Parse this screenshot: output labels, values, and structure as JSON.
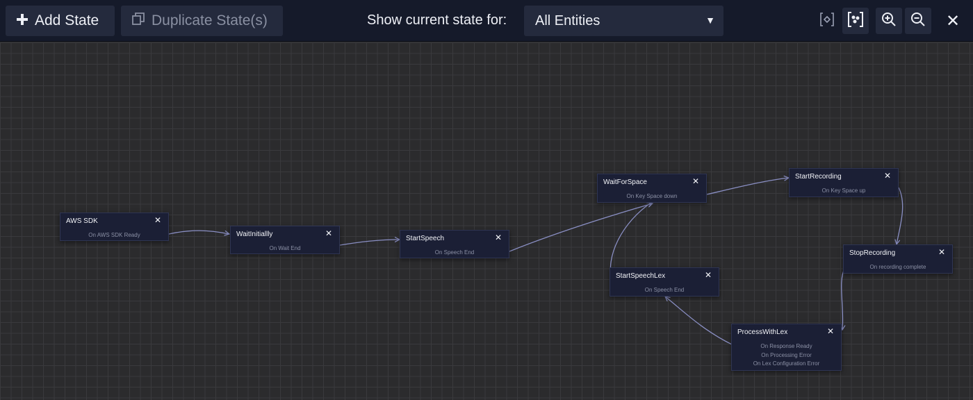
{
  "toolbar": {
    "add_state_label": "Add State",
    "duplicate_state_label": "Duplicate State(s)",
    "show_current_label": "Show current state for:",
    "entity_select_value": "All Entities",
    "icons": [
      "plus-icon",
      "duplicate-icon",
      "chevron-down-icon",
      "fit-selection-icon",
      "fit-all-icon",
      "zoom-in-icon",
      "zoom-out-icon",
      "close-icon"
    ]
  },
  "colors": {
    "toolbar_bg": "#151a2a",
    "button_bg": "#242a3d",
    "canvas_bg": "#2b2b2d",
    "node_bg": "#1b1f35",
    "edge": "#8a8fc4"
  },
  "states": {
    "aws_sdk": {
      "name": "AWS SDK",
      "events": [
        "On AWS SDK Ready"
      ]
    },
    "wait_initially": {
      "name": "WaitInitiallly",
      "events": [
        "On Wait End"
      ]
    },
    "start_speech": {
      "name": "StartSpeech",
      "events": [
        "On Speech End"
      ]
    },
    "wait_for_space": {
      "name": "WaitForSpace",
      "events": [
        "On Key Space down"
      ]
    },
    "start_recording": {
      "name": "StartRecording",
      "events": [
        "On Key Space up"
      ]
    },
    "stop_recording": {
      "name": "StopRecording",
      "events": [
        "On recording complete"
      ]
    },
    "start_speech_lex": {
      "name": "StartSpeechLex",
      "events": [
        "On Speech End"
      ]
    },
    "process_with_lex": {
      "name": "ProcessWithLex",
      "events": [
        "On Response Ready",
        "On Processing Error",
        "On Lex Configuration Error"
      ]
    }
  },
  "transitions": [
    {
      "from": "AWS SDK",
      "event": "On AWS SDK Ready",
      "to": "WaitInitiallly"
    },
    {
      "from": "WaitInitiallly",
      "event": "On Wait End",
      "to": "StartSpeech"
    },
    {
      "from": "StartSpeech",
      "event": "On Speech End",
      "to": "WaitForSpace"
    },
    {
      "from": "WaitForSpace",
      "event": "On Key Space down",
      "to": "StartRecording"
    },
    {
      "from": "StartRecording",
      "event": "On Key Space up",
      "to": "StopRecording"
    },
    {
      "from": "StopRecording",
      "event": "On recording complete",
      "to": "ProcessWithLex"
    },
    {
      "from": "ProcessWithLex",
      "event": "On Response Ready",
      "to": "StartSpeechLex"
    },
    {
      "from": "StartSpeechLex",
      "event": "On Speech End",
      "to": "WaitForSpace"
    }
  ]
}
